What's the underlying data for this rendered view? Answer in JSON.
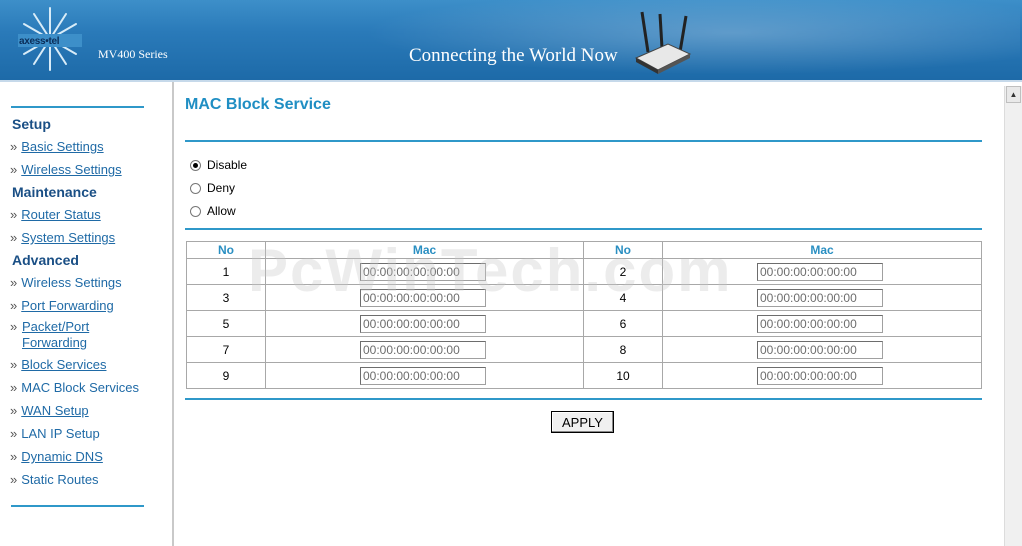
{
  "header": {
    "brand": "axess•tel",
    "series": "MV400 Series",
    "tagline": "Connecting the World Now"
  },
  "sidebar": {
    "sections": [
      {
        "title": "Setup",
        "items": [
          {
            "label": "Basic Settings",
            "link": true
          },
          {
            "label": "Wireless Settings",
            "link": true
          }
        ]
      },
      {
        "title": "Maintenance",
        "items": [
          {
            "label": "Router Status",
            "link": true
          },
          {
            "label": "System Settings",
            "link": true
          }
        ]
      },
      {
        "title": "Advanced",
        "items": [
          {
            "label": "Wireless Settings",
            "link": false
          },
          {
            "label": "Port Forwarding",
            "link": true
          },
          {
            "label": "Packet/Port Forwarding",
            "link": true
          },
          {
            "label": "Block Services",
            "link": true
          },
          {
            "label": "MAC Block Services",
            "link": false
          },
          {
            "label": "WAN Setup",
            "link": true
          },
          {
            "label": "LAN IP Setup",
            "link": false
          },
          {
            "label": "Dynamic DNS",
            "link": true
          },
          {
            "label": "Static Routes",
            "link": false
          }
        ]
      }
    ],
    "raquo": "»"
  },
  "main": {
    "title": "MAC Block Service",
    "options": [
      {
        "label": "Disable",
        "selected": true
      },
      {
        "label": "Deny",
        "selected": false
      },
      {
        "label": "Allow",
        "selected": false
      }
    ],
    "table": {
      "headers": [
        "No",
        "Mac",
        "No",
        "Mac"
      ],
      "rows": [
        {
          "left_no": "1",
          "left_mac": "00:00:00:00:00:00",
          "right_no": "2",
          "right_mac": "00:00:00:00:00:00"
        },
        {
          "left_no": "3",
          "left_mac": "00:00:00:00:00:00",
          "right_no": "4",
          "right_mac": "00:00:00:00:00:00"
        },
        {
          "left_no": "5",
          "left_mac": "00:00:00:00:00:00",
          "right_no": "6",
          "right_mac": "00:00:00:00:00:00"
        },
        {
          "left_no": "7",
          "left_mac": "00:00:00:00:00:00",
          "right_no": "8",
          "right_mac": "00:00:00:00:00:00"
        },
        {
          "left_no": "9",
          "left_mac": "00:00:00:00:00:00",
          "right_no": "10",
          "right_mac": "00:00:00:00:00:00"
        }
      ]
    },
    "apply_label": "APPLY",
    "watermark": "PcWinTech.com"
  },
  "colors": {
    "header_blue": "#2a7ab9",
    "accent_rule": "#2f98c9",
    "link": "#1f6aa6",
    "section_head": "#1a4f85",
    "table_head": "#2a8fc2"
  },
  "icons": {
    "logo": "starburst-logo-icon",
    "router": "router-image-icon",
    "scroll_up": "scroll-up-arrow-icon"
  }
}
